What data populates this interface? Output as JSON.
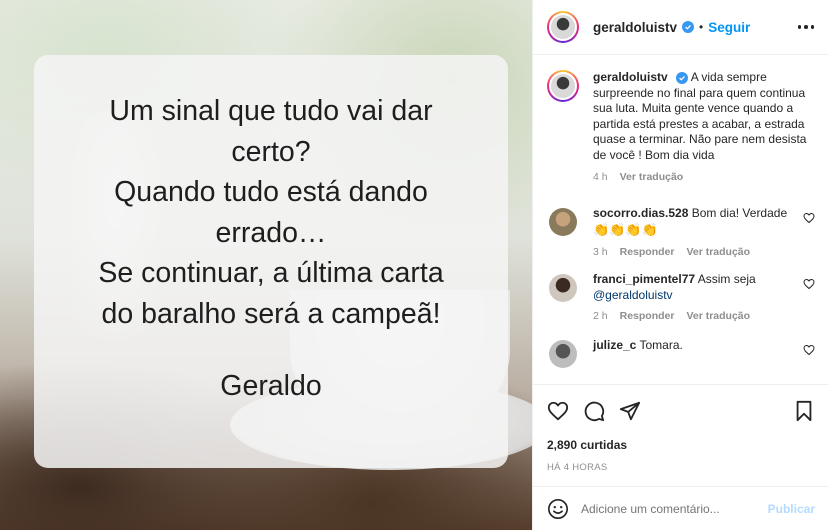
{
  "post": {
    "quote_lines": [
      "Um sinal que tudo vai dar",
      "certo?",
      "Quando tudo está dando",
      "errado…",
      "Se continuar, a última carta",
      "do baralho será a campeã!"
    ],
    "signature": "Geraldo"
  },
  "header": {
    "username": "geraldoluistv",
    "separator": "•",
    "follow_label": "Seguir"
  },
  "caption": {
    "username": "geraldoluistv",
    "text": "A vida sempre surpreende no final para quem continua sua luta. Muita gente vence quando a partida está prestes a acabar, a estrada quase a terminar. Não pare nem desista de você ! Bom dia vida",
    "time": "4 h",
    "translate": "Ver tradução"
  },
  "comments": [
    {
      "username": "socorro.dias.528",
      "text": "Bom dia! Verdade",
      "emojis": "👏👏👏👏",
      "time": "3 h",
      "reply": "Responder",
      "translate": "Ver tradução"
    },
    {
      "username": "franci_pimentel77",
      "text": "Assim seja",
      "mention": "@geraldoluistv",
      "time": "2 h",
      "reply": "Responder",
      "translate": "Ver tradução"
    },
    {
      "username": "julize_c",
      "text": "Tomara."
    }
  ],
  "actions": {
    "likes": "2,890 curtidas",
    "posted_ago": "HÁ 4 HORAS"
  },
  "add_comment": {
    "placeholder": "Adicione um comentário...",
    "publish_label": "Publicar"
  },
  "colors": {
    "link_blue": "#0095f6",
    "verified_blue": "#3897f0",
    "muted_gray": "#8e8e8e",
    "publish_disabled": "#b3dbff"
  }
}
